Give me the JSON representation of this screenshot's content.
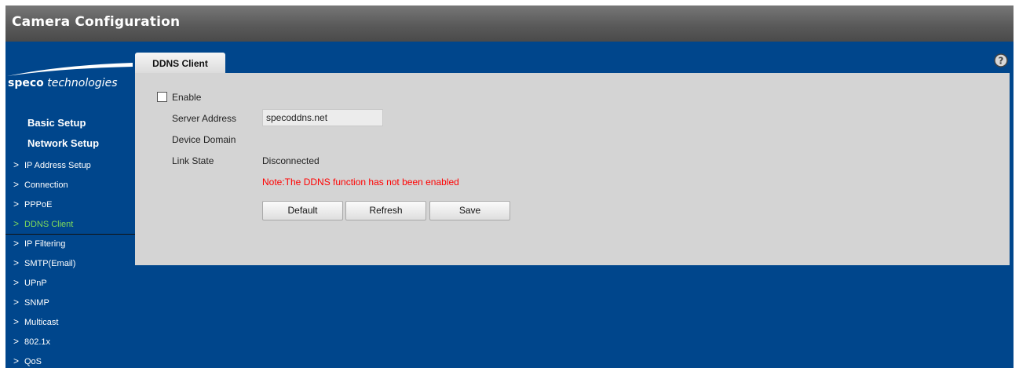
{
  "header": {
    "title": "Camera Configuration"
  },
  "logo": {
    "brand_bold": "speco",
    "brand_rest": " technologies"
  },
  "sidebar": {
    "sections": [
      "Basic Setup",
      "Network Setup"
    ],
    "chevron": ">",
    "items": [
      {
        "label": "IP Address Setup",
        "active": false
      },
      {
        "label": "Connection",
        "active": false
      },
      {
        "label": "PPPoE",
        "active": false
      },
      {
        "label": "DDNS Client",
        "active": true
      },
      {
        "label": "IP Filtering",
        "active": false
      },
      {
        "label": "SMTP(Email)",
        "active": false
      },
      {
        "label": "UPnP",
        "active": false
      },
      {
        "label": "SNMP",
        "active": false
      },
      {
        "label": "Multicast",
        "active": false
      },
      {
        "label": "802.1x",
        "active": false
      },
      {
        "label": "QoS",
        "active": false
      }
    ]
  },
  "tab": {
    "label": "DDNS Client"
  },
  "form": {
    "enable_label": "Enable",
    "enable_checked": false,
    "server_address_label": "Server Address",
    "server_address_value": "specoddns.net",
    "device_domain_label": "Device Domain",
    "link_state_label": "Link State",
    "link_state_value": "Disconnected",
    "note": "Note:The DDNS function has not been enabled"
  },
  "buttons": {
    "default": "Default",
    "refresh": "Refresh",
    "save": "Save"
  },
  "icons": {
    "help": "help-circle-icon",
    "chevron": "chevron-right-icon"
  },
  "colors": {
    "background": "#00468c",
    "active_item": "#7fdb5a",
    "note": "#ff0000",
    "panel": "#d4d4d4"
  }
}
